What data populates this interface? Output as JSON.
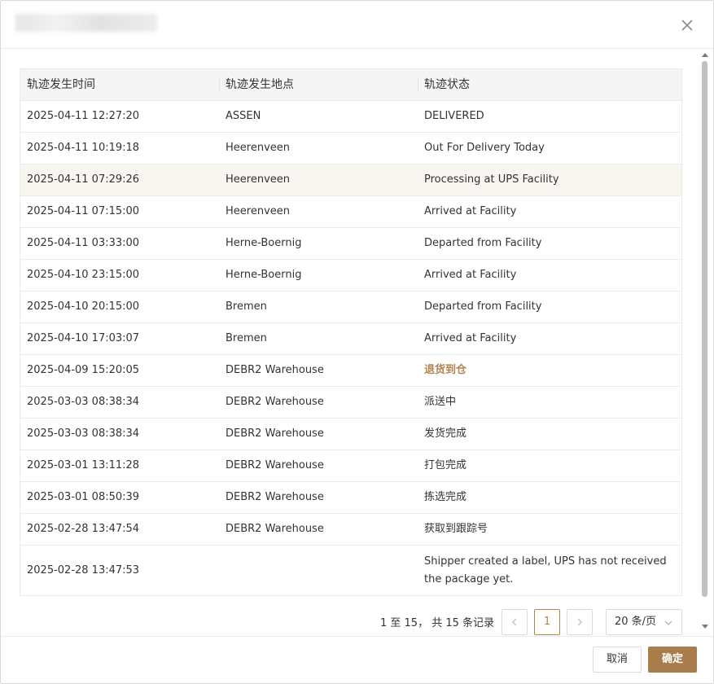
{
  "modal": {
    "close_icon": "close-icon"
  },
  "table": {
    "headers": [
      "轨迹发生时间",
      "轨迹发生地点",
      "轨迹状态"
    ],
    "rows": [
      {
        "time": "2025-04-11 12:27:20",
        "location": "ASSEN",
        "status": "DELIVERED"
      },
      {
        "time": "2025-04-11 10:19:18",
        "location": "Heerenveen",
        "status": "Out For Delivery Today"
      },
      {
        "time": "2025-04-11 07:29:26",
        "location": "Heerenveen",
        "status": "Processing at UPS Facility"
      },
      {
        "time": "2025-04-11 07:15:00",
        "location": "Heerenveen",
        "status": "Arrived at Facility"
      },
      {
        "time": "2025-04-11 03:33:00",
        "location": "Herne-Boernig",
        "status": "Departed from Facility"
      },
      {
        "time": "2025-04-10 23:15:00",
        "location": "Herne-Boernig",
        "status": "Arrived at Facility"
      },
      {
        "time": "2025-04-10 20:15:00",
        "location": "Bremen",
        "status": "Departed from Facility"
      },
      {
        "time": "2025-04-10 17:03:07",
        "location": "Bremen",
        "status": "Arrived at Facility"
      },
      {
        "time": "2025-04-09 15:20:05",
        "location": "DEBR2 Warehouse",
        "status": "退货到仓"
      },
      {
        "time": "2025-03-03 08:38:34",
        "location": "DEBR2 Warehouse",
        "status": "派送中"
      },
      {
        "time": "2025-03-03 08:38:34",
        "location": "DEBR2 Warehouse",
        "status": "发货完成"
      },
      {
        "time": "2025-03-01 13:11:28",
        "location": "DEBR2 Warehouse",
        "status": "打包完成"
      },
      {
        "time": "2025-03-01 08:50:39",
        "location": "DEBR2 Warehouse",
        "status": "拣选完成"
      },
      {
        "time": "2025-02-28 13:47:54",
        "location": "DEBR2 Warehouse",
        "status": "获取到跟踪号"
      },
      {
        "time": "2025-02-28 13:47:53",
        "location": "",
        "status": "Shipper created a label, UPS has not received the package yet."
      }
    ]
  },
  "pagination": {
    "summary": "1 至 15， 共 15 条记录",
    "current_page": "1",
    "page_size": "20 条/页"
  },
  "footer": {
    "cancel_label": "取消",
    "ok_label": "确定"
  },
  "colors": {
    "accent": "#a87d4b",
    "highlight_row": "#f9f5f1"
  }
}
